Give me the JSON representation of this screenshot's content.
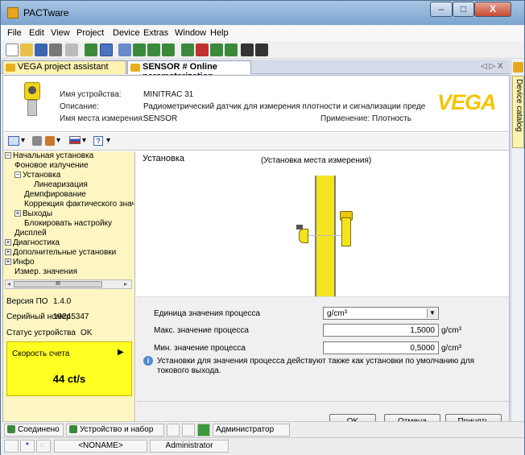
{
  "window": {
    "title": "PACTware",
    "min": "–",
    "max": "□",
    "close": "X"
  },
  "menu": [
    "File",
    "Edit",
    "View",
    "Project",
    "Device",
    "Extras",
    "Window",
    "Help"
  ],
  "tabs": {
    "inactive": "VEGA project assistant",
    "active": "SENSOR # Online parameterization",
    "nav": "◁ ▷ X"
  },
  "catalog": {
    "label": "Device catalog"
  },
  "device": {
    "name_label": "Имя устройства:",
    "name": "MINITRAC 31",
    "desc_label": "Описание:",
    "desc": "Радиометрический датчик для измерения плотности и сигнализации предельного у...",
    "tag_label": "Имя места измерения:",
    "tag": "SENSOR",
    "app_label": "Применение:",
    "app": "Плотность",
    "logo": "VEGA"
  },
  "tree": [
    {
      "label": "Начальная установка",
      "exp": "−"
    },
    {
      "label": "Фоновое излучение",
      "exp": ""
    },
    {
      "label": "Установка",
      "exp": "−"
    },
    {
      "label": "Линеаризация",
      "exp": ""
    },
    {
      "label": "Демпфирование",
      "exp": ""
    },
    {
      "label": "Коррекция фактического знач",
      "exp": ""
    },
    {
      "label": "Выходы",
      "exp": "+"
    },
    {
      "label": "Блокировать настройку",
      "exp": ""
    },
    {
      "label": "Дисплей",
      "exp": ""
    },
    {
      "label": "Диагностика",
      "exp": "+"
    },
    {
      "label": "Дополнительные установки",
      "exp": "+"
    },
    {
      "label": "Инфо",
      "exp": "+"
    },
    {
      "label": "Измер. значения",
      "exp": ""
    }
  ],
  "scroll_thumb": "III",
  "info": {
    "sw_label": "Версия ПО",
    "sw": "1.4.0",
    "sn_label": "Серийный номер",
    "sn": "19245347",
    "status_label": "Статус устройства",
    "status": "OK"
  },
  "rate": {
    "label": "Скорость счета",
    "value": "44 ct/s"
  },
  "section": {
    "title": "Установка",
    "subtitle": "(Установка места измерения)"
  },
  "form": {
    "unit_label": "Единица значения процесса",
    "unit_value": "g/cm³",
    "max_label": "Макс. значение процесса",
    "max_value": "1,5000",
    "max_unit": "g/cm³",
    "min_label": "Мин. значение процесса",
    "min_value": "0,5000",
    "min_unit": "g/cm³",
    "note": "Установки для значения процесса действуют также как установки по умолчанию для токового выхода."
  },
  "buttons": {
    "ok": "OK",
    "cancel": "Отмена",
    "apply": "Принять"
  },
  "status1": {
    "connected": "Соединено",
    "device": "Устройство и набор",
    "role": "Администратор"
  },
  "status2": {
    "project": "<NONAME>",
    "user": "Administrator"
  }
}
